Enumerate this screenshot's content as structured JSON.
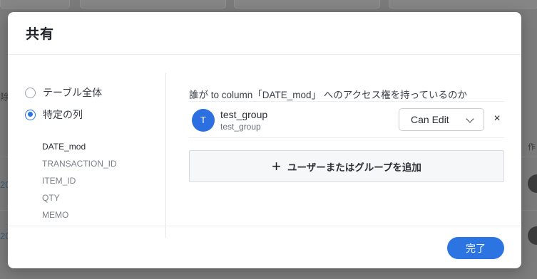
{
  "background": {
    "left_texts": [
      "除",
      "20",
      "20"
    ],
    "right_text": "作"
  },
  "modal": {
    "title": "共有",
    "scope_options": [
      {
        "label": "テーブル全体",
        "checked": false
      },
      {
        "label": "特定の列",
        "checked": true
      }
    ],
    "columns": [
      "DATE_mod",
      "TRANSACTION_ID",
      "ITEM_ID",
      "QTY",
      "MEMO"
    ],
    "access_title": "誰が to column「DATE_mod」 へのアクセス権を持っているのか",
    "member": {
      "avatar_letter": "T",
      "name": "test_group",
      "sub": "test_group",
      "permission": "Can Edit"
    },
    "remove_symbol": "×",
    "add_button_label": "ユーザーまたはグループを追加",
    "done_label": "完了"
  },
  "colors": {
    "accent": "#2b74e2",
    "avatar": "#2b6fe0"
  },
  "icons": {
    "add": "plus-icon",
    "permission_dropdown": "chevron-down-icon",
    "remove": "close-icon"
  }
}
